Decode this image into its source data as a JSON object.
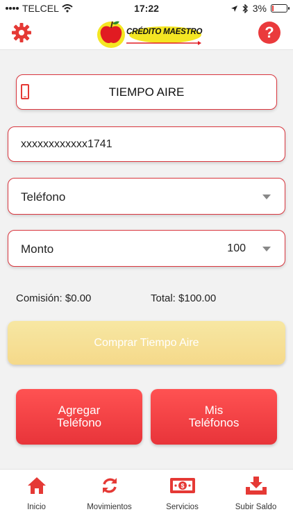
{
  "status_bar": {
    "carrier": "TELCEL",
    "time": "17:22",
    "battery": "3%"
  },
  "header": {
    "logo_text": "CRÉDITO MAESTRO",
    "help_glyph": "?",
    "icons": {
      "settings": "gear-icon",
      "help": "help-icon"
    }
  },
  "form": {
    "product_label": "TIEMPO AIRE",
    "account_value": "xxxxxxxxxxxx1741",
    "phone_select_label": "Teléfono",
    "amount_select_label": "Monto",
    "amount_value": "100"
  },
  "summary": {
    "commission": "Comisión: $0.00",
    "total": "Total: $100.00"
  },
  "buttons": {
    "buy_label": "Comprar Tiempo Aire",
    "add_phone_line1": "Agregar",
    "add_phone_line2": "Teléfono",
    "my_phones_line1": "Mis",
    "my_phones_line2": "Teléfonos"
  },
  "tabs": [
    {
      "label": "Inicio",
      "icon": "home-icon"
    },
    {
      "label": "Movimientos",
      "icon": "refresh-icon"
    },
    {
      "label": "Servicios",
      "icon": "cash-icon"
    },
    {
      "label": "Subir Saldo",
      "icon": "download-icon"
    }
  ],
  "colors": {
    "accent_red": "#e8343a",
    "buy_yellow": "#f5d98a",
    "logo_yellow": "#f4e623"
  }
}
